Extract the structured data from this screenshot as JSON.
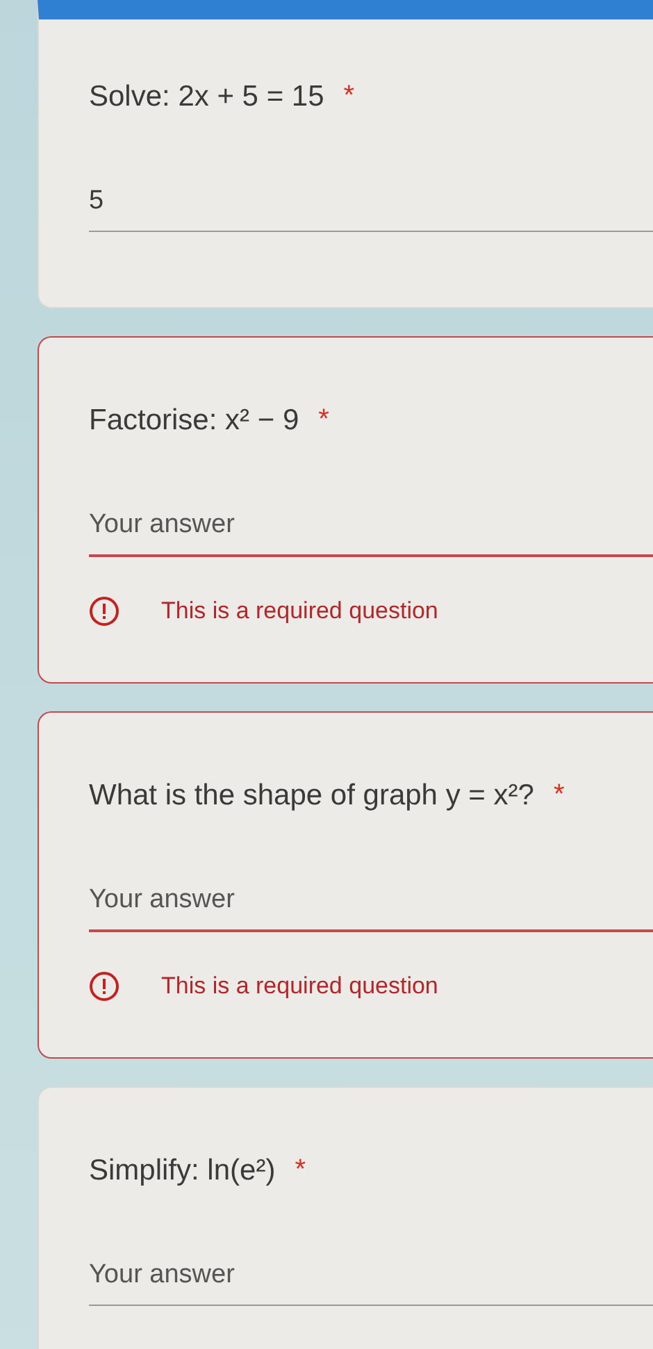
{
  "questions": [
    {
      "prompt": "Solve: 2x + 5 = 15",
      "required_mark": "*",
      "answer": {
        "value": "5"
      },
      "invalid": false,
      "header": true
    },
    {
      "prompt": "Factorise: x² − 9",
      "required_mark": "*",
      "answer": {
        "placeholder": "Your answer"
      },
      "invalid": true,
      "error": "This is a required question",
      "header": false
    },
    {
      "prompt": "What is the shape of graph y = x²?",
      "required_mark": "*",
      "answer": {
        "placeholder": "Your answer"
      },
      "invalid": true,
      "error": "This is a required question",
      "header": false
    },
    {
      "prompt": "Simplify: ln(e²)",
      "required_mark": "*",
      "answer": {
        "placeholder": "Your answer"
      },
      "invalid": false,
      "header": false
    }
  ]
}
